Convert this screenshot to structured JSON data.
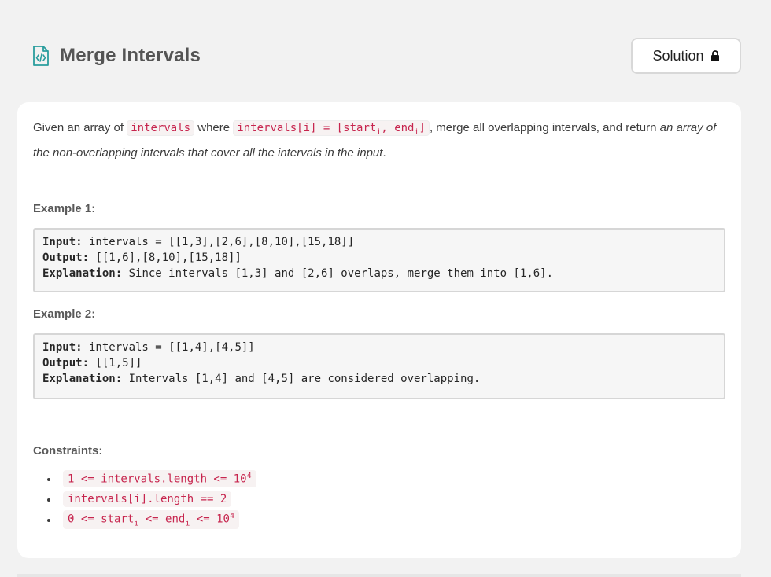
{
  "header": {
    "icon": "code-file-icon",
    "title": "Merge Intervals",
    "solution_label": "Solution",
    "solution_icon": "lock-icon"
  },
  "description": {
    "p1": "Given an array of ",
    "code1": "intervals",
    "p2": " where ",
    "code2_a": "intervals[i] = [start",
    "code2_sub1": "i",
    "code2_b": ", end",
    "code2_sub2": "i",
    "code2_c": "]",
    "p3": ", merge all overlapping intervals, and return ",
    "em": "an array of the non-overlapping intervals that cover all the intervals in the input",
    "p4": "."
  },
  "examples": [
    {
      "label": "Example 1:",
      "input_key": "Input:",
      "input_val": " intervals = [[1,3],[2,6],[8,10],[15,18]]",
      "output_key": "Output:",
      "output_val": " [[1,6],[8,10],[15,18]]",
      "explanation_key": "Explanation:",
      "explanation_val": " Since intervals [1,3] and [2,6] overlaps, merge them into [1,6]."
    },
    {
      "label": "Example 2:",
      "input_key": "Input:",
      "input_val": " intervals = [[1,4],[4,5]]",
      "output_key": "Output:",
      "output_val": " [[1,5]]",
      "explanation_key": "Explanation:",
      "explanation_val": " Intervals [1,4] and [4,5] are considered overlapping."
    }
  ],
  "constraints": {
    "label": "Constraints:",
    "c1_a": "1 <= intervals.length <= 10",
    "c1_sup": "4",
    "c2": "intervals[i].length == 2",
    "c3_a": "0 <= start",
    "c3_sub1": "i",
    "c3_b": " <= end",
    "c3_sub2": "i",
    "c3_c": " <= 10",
    "c3_sup": "4"
  },
  "colors": {
    "code_text": "#c7254e",
    "code_bg": "#f7f2f2",
    "icon_teal": "#2a9d9d",
    "page_bg": "#f2f2f2"
  }
}
